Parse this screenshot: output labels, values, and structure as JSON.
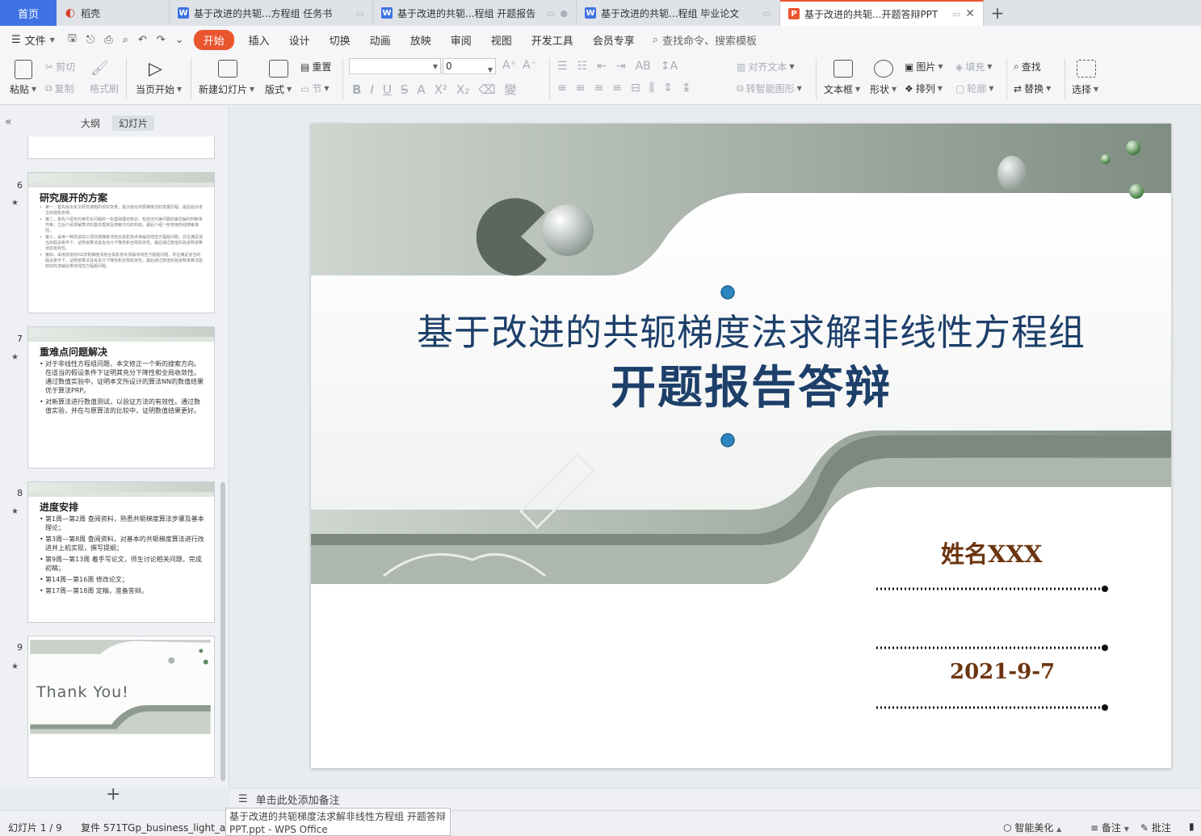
{
  "tabs": {
    "home": "首页",
    "items": [
      {
        "label": "稻壳",
        "icon": "daoke-icon"
      },
      {
        "label": "基于改进的共轭...方程组 任务书",
        "icon": "word-icon"
      },
      {
        "label": "基于改进的共轭...程组 开题报告",
        "icon": "word-icon"
      },
      {
        "label": "基于改进的共轭...程组 毕业论文",
        "icon": "word-icon"
      },
      {
        "label": "基于改进的共轭...开题答辩PPT",
        "icon": "ppt-icon"
      }
    ]
  },
  "menu": {
    "file": "文件",
    "items": [
      "开始",
      "插入",
      "设计",
      "切换",
      "动画",
      "放映",
      "审阅",
      "视图",
      "开发工具",
      "会员专享"
    ],
    "search": "查找命令、搜索模板"
  },
  "ribbon": {
    "paste": "粘贴",
    "cut": "剪切",
    "copy": "复制",
    "format_painter": "格式刷",
    "from_current": "当页开始",
    "new_slide": "新建幻灯片",
    "layout": "版式",
    "section": "节",
    "reset": "重置",
    "font_size": "0",
    "align_text": "对齐文本",
    "smart_art": "转智能图形",
    "textbox": "文本框",
    "shape": "形状",
    "picture": "图片",
    "arrange": "排列",
    "fill": "填充",
    "outline": "轮廓",
    "find": "查找",
    "replace": "替换",
    "select": "选择"
  },
  "left_panel": {
    "tab_outline": "大纲",
    "tab_slides": "幻灯片",
    "thumbs": [
      {
        "num": "6",
        "title": "研究展开的方案",
        "bullets": [
          "第一，首先给出本文研究课题的现实背景，其次给出共轭梯度法的发展历程，最后给出本文的结构安排。",
          "第二，首先介绍无约束优化问题的一些基础理论知识，包括无约束问题的最优解的判断条件等；之后介绍求解算法的基本框架及搜索方向的构造，最后介绍一些常用的线搜索准则。",
          "第三，采用一种改进的三项共轭梯度法结合投影技术来解非线性方程组问题，并在满足适当的假设条件下，证明该算法具有充分下降性和全局收敛性，最后通过数值实验说明该算法的有效性。",
          "第四，采用改进的HZ共轭梯度法结合投影技术求解非线性方程组问题，并在满足适当的假设条件下，证明该算法具有充分下降性和全局收敛性，最后通过数值实验说明该算法能较好的求解此类非线性方程组问题。"
        ]
      },
      {
        "num": "7",
        "title": "重难点问题解决",
        "bullets": [
          "对于非线性方程组问题，本文修正一个新的搜索方向。在适当的假设条件下证明其充分下降性和全局收敛性。通过数值实验中，证明本文所设计的算法NN的数值结果优于算法PRP。",
          "对新算法进行数值测试，以验证方法的有效性。通过数值实验，并在与原算法的比较中，证明数值结果更好。"
        ]
      },
      {
        "num": "8",
        "title": "进度安排",
        "bullets": [
          "第1周—第2周  查阅资料，熟悉共轭梯度算法步骤及基本理论；",
          "第3周—第8周  查阅资料，对基本的共轭梯度算法进行改进并上机实现，撰写提纲；",
          "第9周—第13周  着手写论文，师生讨论相关问题，完成初稿；",
          "第14周—第16周  修改论文；",
          "第17周—第18周  定稿，准备答辩。"
        ]
      },
      {
        "num": "9",
        "title": "Thank You!",
        "bullets": []
      }
    ]
  },
  "slide": {
    "title_line1": "基于改进的共轭梯度法求解非线性方程组",
    "title_line2": "开题报告答辩",
    "name": "姓名XXX",
    "date": "2021-9-7"
  },
  "notes_placeholder": "单击此处添加备注",
  "status": {
    "slide_counter": "幻灯片 1 / 9",
    "theme": "复件 571TGp_business_light_an",
    "tooltip": "基于改进的共轭梯度法求解非线性方程组 开题答辩PPT.ppt - WPS Office",
    "smart_beautify": "智能美化",
    "notes": "备注",
    "comments": "批注"
  },
  "colors": {
    "accent": "#e9552f",
    "home_tab": "#3f73e3",
    "title": "#1d3f6a",
    "name_date": "#6b3510"
  }
}
